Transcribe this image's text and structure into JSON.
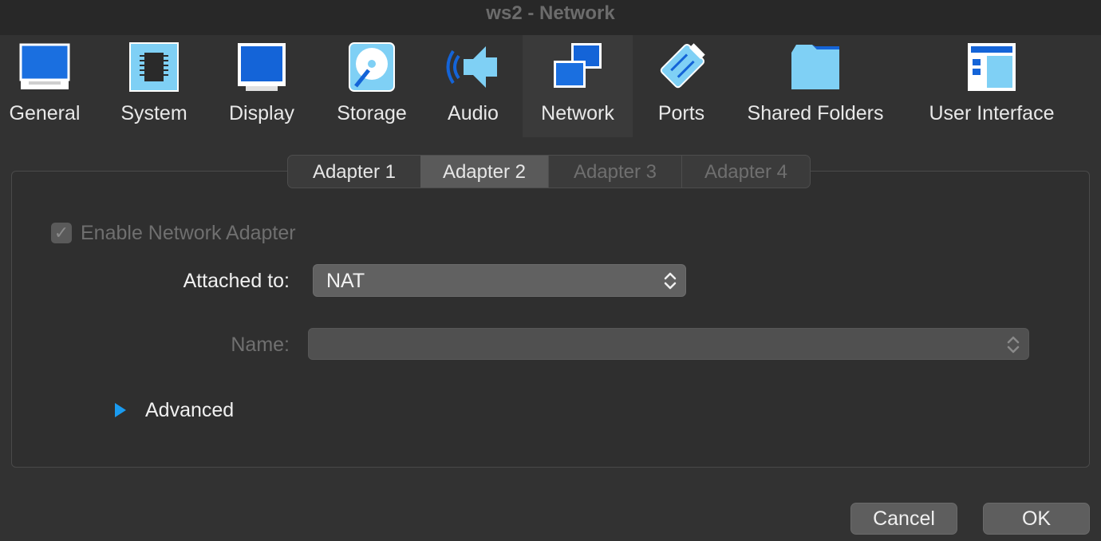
{
  "window": {
    "title": "ws2 - Network"
  },
  "toolbar": {
    "items": [
      {
        "label": "General",
        "icon": "general-icon"
      },
      {
        "label": "System",
        "icon": "system-chip-icon"
      },
      {
        "label": "Display",
        "icon": "display-monitor-icon"
      },
      {
        "label": "Storage",
        "icon": "storage-disk-icon"
      },
      {
        "label": "Audio",
        "icon": "audio-speaker-icon"
      },
      {
        "label": "Network",
        "icon": "network-icon",
        "selected": true
      },
      {
        "label": "Ports",
        "icon": "ports-icon"
      },
      {
        "label": "Shared Folders",
        "icon": "folder-icon"
      },
      {
        "label": "User Interface",
        "icon": "user-interface-icon"
      }
    ]
  },
  "tabs": [
    {
      "label": "Adapter 1",
      "enabled": true,
      "active": false
    },
    {
      "label": "Adapter 2",
      "enabled": true,
      "active": true
    },
    {
      "label": "Adapter 3",
      "enabled": false,
      "active": false
    },
    {
      "label": "Adapter 4",
      "enabled": false,
      "active": false
    }
  ],
  "adapter": {
    "enable_label": "Enable Network Adapter",
    "enable_checked": true,
    "attached_label": "Attached to:",
    "attached_value": "NAT",
    "name_label": "Name:",
    "name_value": "",
    "advanced_label": "Advanced"
  },
  "buttons": {
    "cancel": "Cancel",
    "ok": "OK"
  },
  "colors": {
    "background": "#323232",
    "accent": "#1a9bf0",
    "icon_blue": "#1464d8",
    "disabled_text": "#6f6f6f"
  }
}
